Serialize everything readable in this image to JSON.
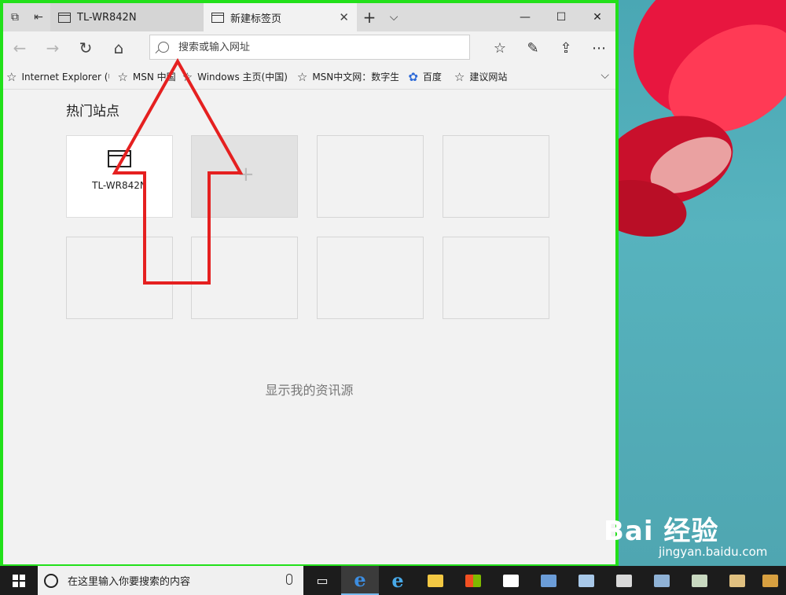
{
  "tabs": [
    {
      "label": "TL-WR842N",
      "active": false
    },
    {
      "label": "新建标签页",
      "active": true
    }
  ],
  "address_bar": {
    "placeholder": "搜索或输入网址"
  },
  "favorites": [
    {
      "label": "Internet Explorer (中国"
    },
    {
      "label": "MSN 中国"
    },
    {
      "label": "Windows 主页(中国)"
    },
    {
      "label": "MSN中文网：数字生"
    },
    {
      "label": "百度"
    },
    {
      "label": "建议网站"
    }
  ],
  "top_sites": {
    "heading": "热门站点",
    "tiles": [
      {
        "label": "TL-WR842N"
      }
    ]
  },
  "feed_link": "显示我的资讯源",
  "taskbar": {
    "search_placeholder": "在这里输入你要搜索的内容"
  },
  "watermark": {
    "brand": "Bai 经验",
    "url": "jingyan.baidu.com"
  },
  "colors": {
    "window_border": "#22e01a",
    "annotation_arrow": "#e52020",
    "taskbar": "#1c1c1c"
  }
}
